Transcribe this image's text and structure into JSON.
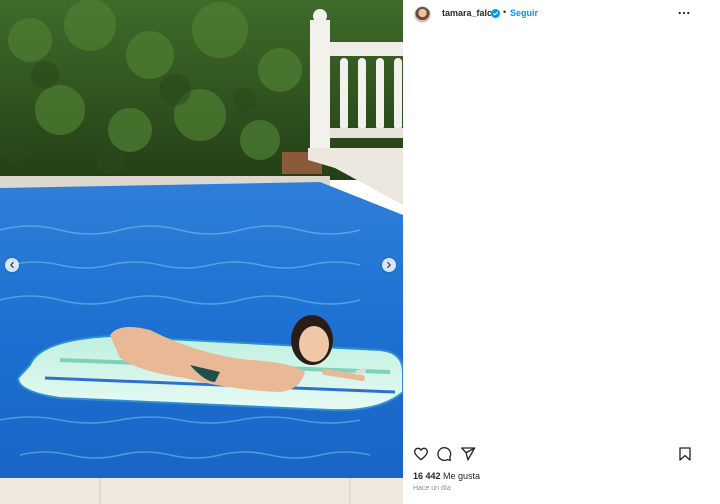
{
  "post": {
    "username": "tamara_falco",
    "separator": "•",
    "follow_label": "Seguir",
    "likes_count": "16 442",
    "likes_label": "Me gusta",
    "time_ago": "Hace un día"
  },
  "icons": {
    "prev": "chevron-left-icon",
    "next": "chevron-right-icon",
    "more": "more-options-icon",
    "like": "heart-icon",
    "comment": "comment-icon",
    "share": "send-icon",
    "save": "bookmark-icon",
    "verified": "verified-badge-icon"
  },
  "colors": {
    "accent": "#0095f6",
    "text": "#262626",
    "muted": "#8e8e8e"
  }
}
